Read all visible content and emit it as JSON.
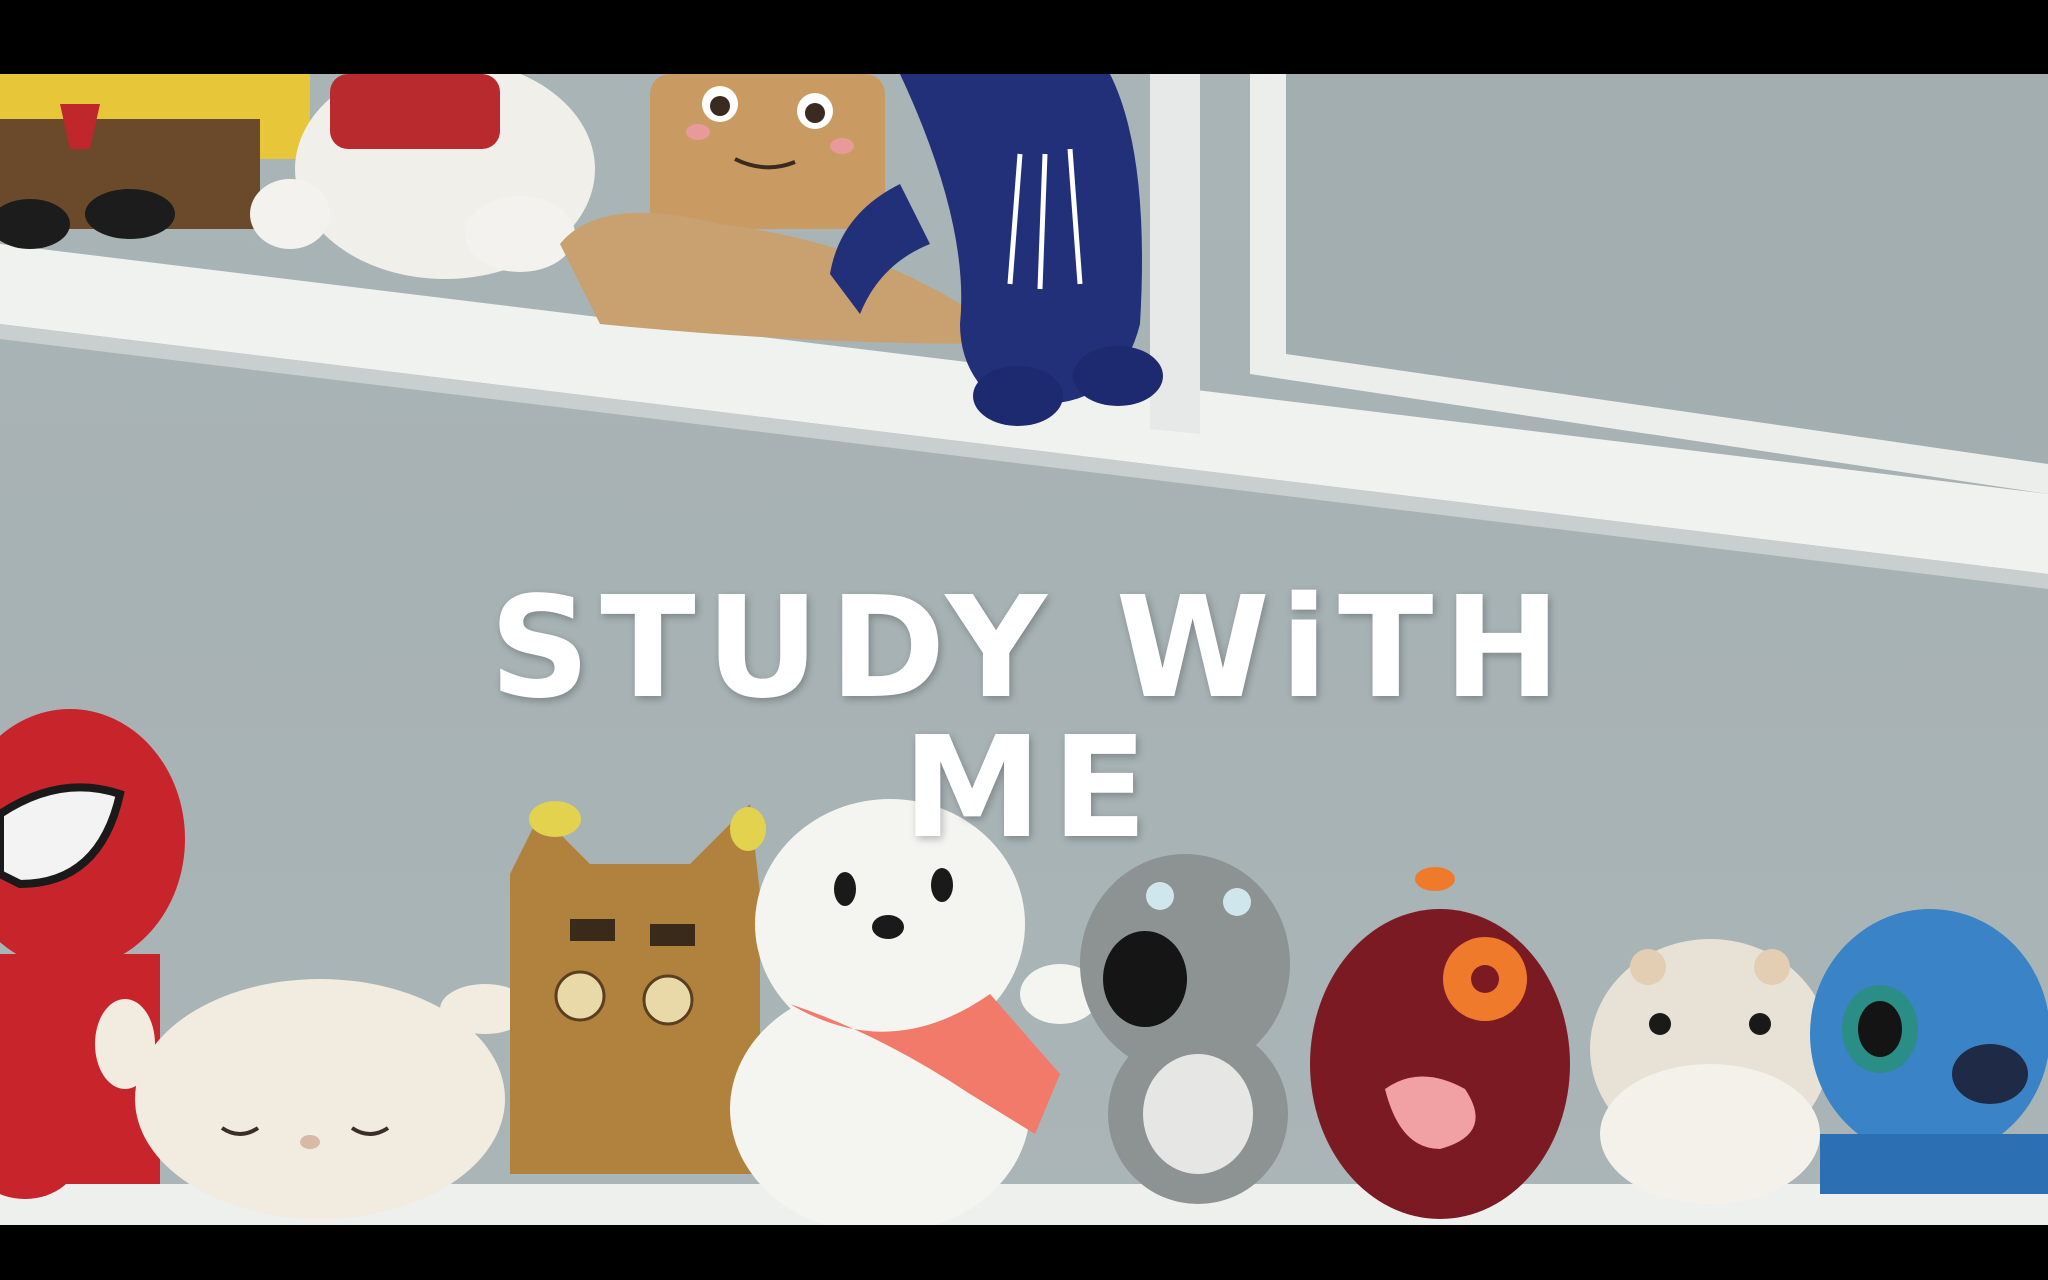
{
  "video": {
    "title": "STUDY WiTH ME"
  },
  "colors": {
    "wall": "#a9b4b6",
    "shelf": "#eef0ee",
    "title_text": "#ffffff",
    "letterbox": "#000000"
  }
}
